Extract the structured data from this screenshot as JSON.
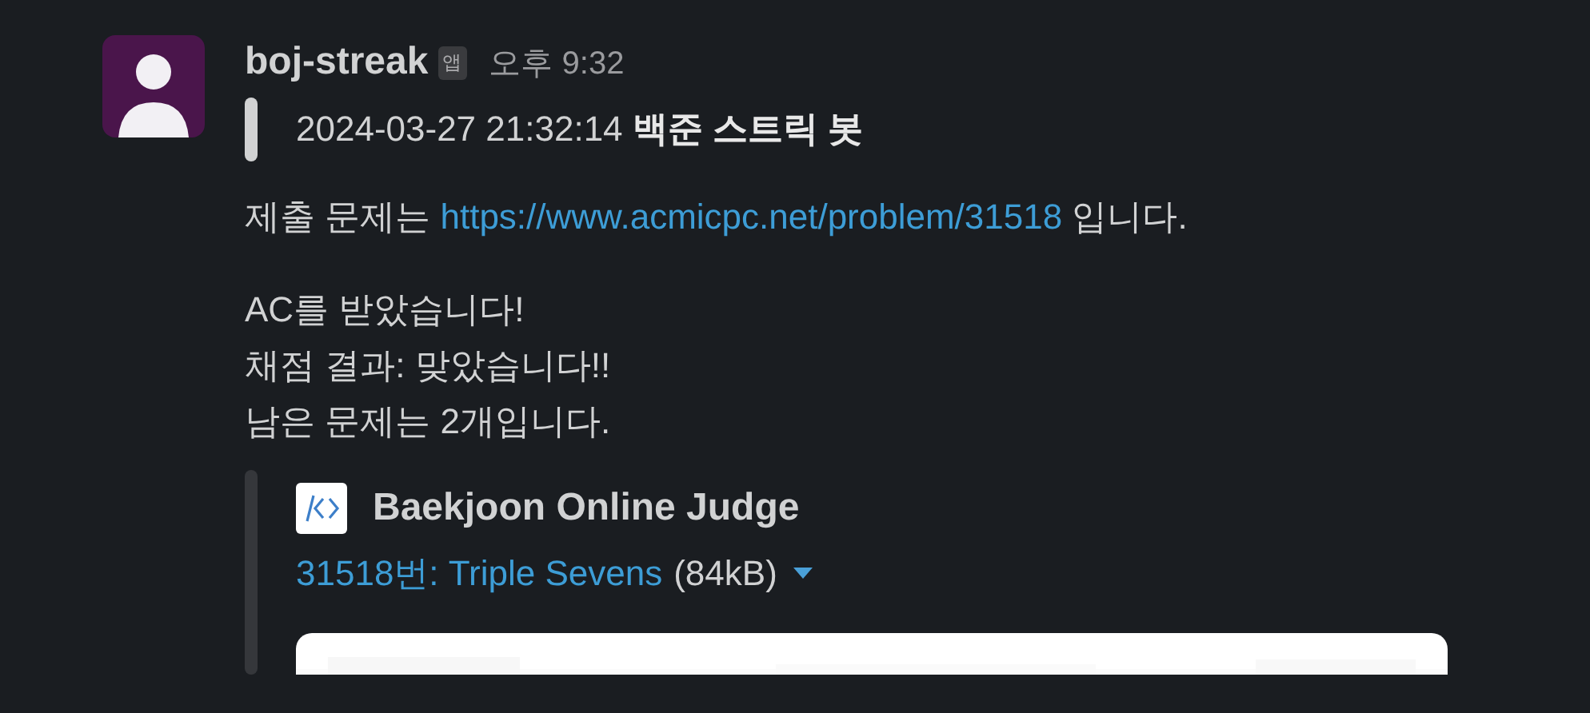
{
  "message": {
    "sender": "boj-streak",
    "badge": "앱",
    "time": "오후 9:32",
    "quote": "2024-03-27 21:32:14 **백준 스트릭 봇**",
    "submission": {
      "before": "제출 문제는",
      "link": "https://www.acmicpc.net/problem/31518",
      "after": "입니다."
    },
    "lines": [
      "AC를 받았습니다!",
      "채점 결과: 맞았습니다!!",
      "남은 문제는 2개입니다."
    ],
    "attachment": {
      "site": "Baekjoon Online Judge",
      "title": "31518번: Triple Sevens",
      "size": "(84kB)",
      "expanded": true
    }
  }
}
